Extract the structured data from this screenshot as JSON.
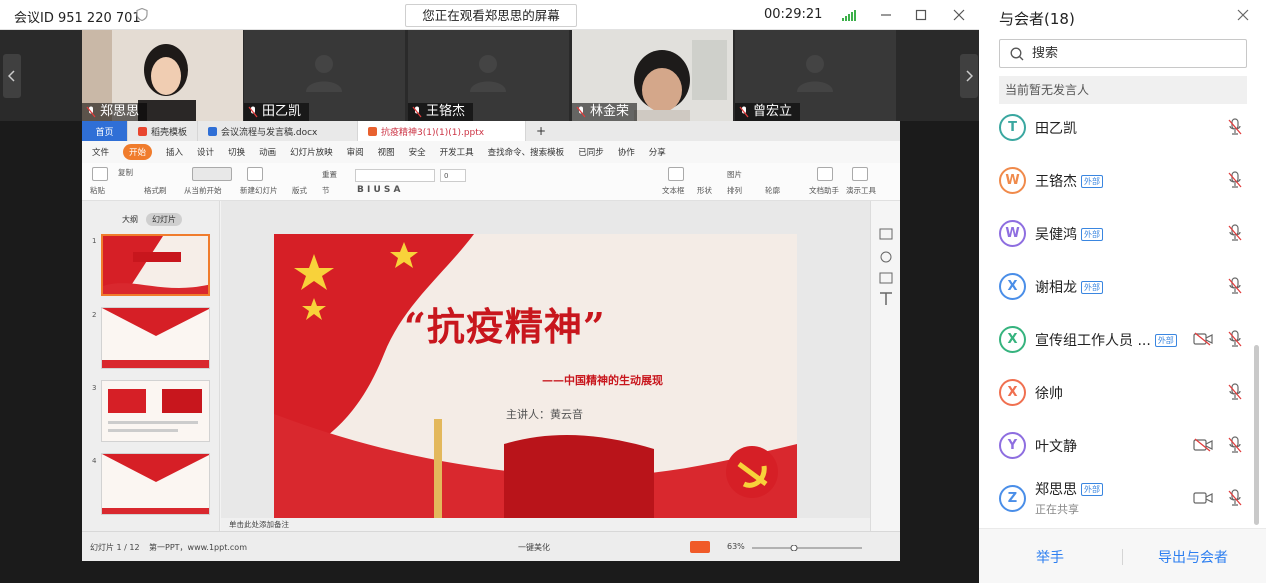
{
  "topbar": {
    "meeting_id": "会议ID 951 220 701",
    "share_banner": "您正在观看郑思思的屏幕",
    "timer": "00:29:21"
  },
  "video_tiles": [
    {
      "name": "郑思思"
    },
    {
      "name": "田乙凯"
    },
    {
      "name": "王铬杰"
    },
    {
      "name": "林金荣"
    },
    {
      "name": "曾宏立"
    }
  ],
  "wps": {
    "tabs": [
      "首页",
      "稻壳模板",
      "会议流程与发言稿.docx",
      "抗疫精神3(1)(1)(1).pptx"
    ],
    "menu": [
      "文件",
      "开始",
      "插入",
      "设计",
      "切换",
      "动画",
      "幻灯片放映",
      "审阅",
      "视图",
      "安全",
      "开发工具",
      "查找命令、搜索模板",
      "已同步",
      "协作",
      "分享"
    ],
    "ribbon": [
      "粘贴",
      "复制",
      "格式刷",
      "从当前开始",
      "新建幻灯片",
      "版式",
      "节",
      "重置",
      "文本框",
      "形状",
      "排列",
      "图片",
      "轮廓",
      "文档助手",
      "演示工具"
    ],
    "font_size": "0",
    "pane_tabs": [
      "大纲",
      "幻灯片"
    ],
    "thumb_numbers": [
      "1",
      "2",
      "3",
      "4"
    ],
    "slide": {
      "title": "“抗疫精神”",
      "subtitle": "——中国精神的生动展现",
      "presenter": "主讲人：黄云音"
    },
    "note_placeholder": "单击此处添加备注",
    "status": {
      "slide_count": "幻灯片 1 / 12",
      "source": "第一PPT，www.1ppt.com",
      "beautify": "一键美化",
      "zoom": "63%"
    }
  },
  "panel": {
    "title": "与会者(18)",
    "search_placeholder": "搜索",
    "speaker_status": "当前暂无发言人",
    "external_label": "外部",
    "participants": [
      {
        "initial": "T",
        "name": "田乙凯",
        "external": false,
        "sub": "",
        "color": "#3aa7a0"
      },
      {
        "initial": "W",
        "name": "王铬杰",
        "external": true,
        "sub": "",
        "color": "#f08a4b"
      },
      {
        "initial": "W",
        "name": "吴健鸿",
        "external": true,
        "sub": "",
        "color": "#8e6ee0"
      },
      {
        "initial": "X",
        "name": "谢相龙",
        "external": true,
        "sub": "",
        "color": "#4a8ee8"
      },
      {
        "initial": "X",
        "name": "宣传组工作人员 ...",
        "external": true,
        "sub": "",
        "color": "#36b37e"
      },
      {
        "initial": "X",
        "name": "徐帅",
        "external": false,
        "sub": "",
        "color": "#f07050"
      },
      {
        "initial": "Y",
        "name": "叶文静",
        "external": false,
        "sub": "",
        "color": "#8e6ee0"
      },
      {
        "initial": "Z",
        "name": "郑思思",
        "external": true,
        "sub": "正在共享",
        "color": "#4a8ee8"
      }
    ],
    "footer": {
      "raise_hand": "举手",
      "export": "导出与会者"
    }
  }
}
